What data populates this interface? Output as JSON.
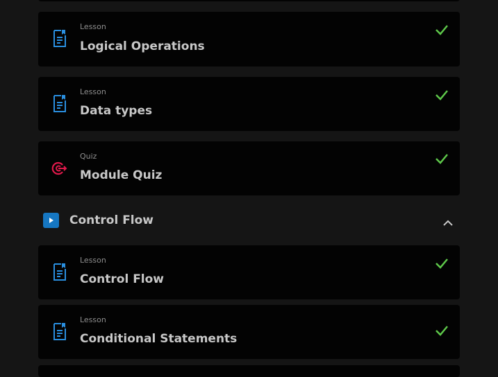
{
  "items_top": [
    {
      "kind": "Lesson",
      "title": "Logical Operations",
      "icon": "lesson-document-icon",
      "status": "completed"
    },
    {
      "kind": "Lesson",
      "title": "Data types",
      "icon": "lesson-document-icon",
      "status": "completed"
    },
    {
      "kind": "Quiz",
      "title": "Module Quiz",
      "icon": "quiz-target-icon",
      "status": "completed"
    }
  ],
  "section": {
    "title": "Control Flow",
    "icon": "play-icon",
    "expanded": true
  },
  "items_bottom": [
    {
      "kind": "Lesson",
      "title": "Control Flow",
      "icon": "lesson-document-icon",
      "status": "completed"
    },
    {
      "kind": "Lesson",
      "title": "Conditional Statements",
      "icon": "lesson-document-icon",
      "status": "completed"
    }
  ],
  "colors": {
    "accent_blue": "#2a8fe0",
    "quiz_red": "#e0194b",
    "check_green": "#5ec84a",
    "background": "#151515",
    "card": "#030303"
  }
}
